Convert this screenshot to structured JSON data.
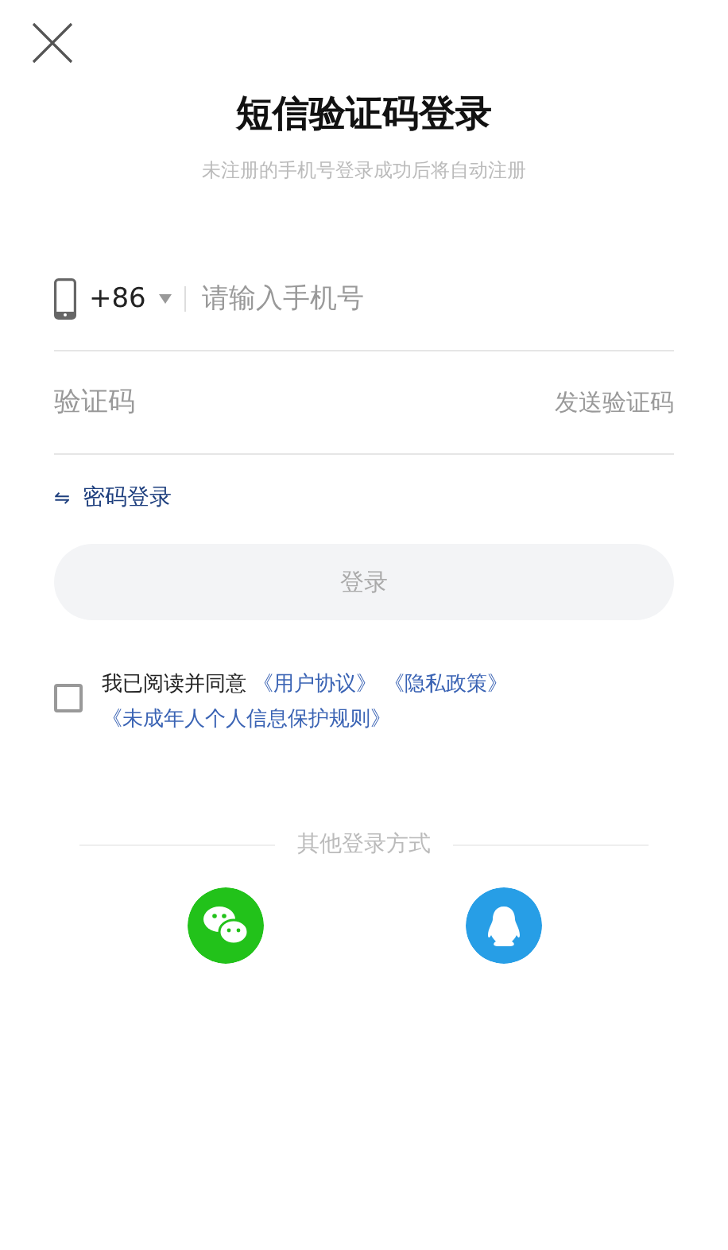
{
  "title": "短信验证码登录",
  "subtitle": "未注册的手机号登录成功后将自动注册",
  "phone_field": {
    "country_code": "+86",
    "placeholder": "请输入手机号"
  },
  "code_field": {
    "placeholder": "验证码",
    "send_button": "发送验证码"
  },
  "switch_link": {
    "icon": "⇋",
    "label": "密码登录"
  },
  "login_button": {
    "label": "登录",
    "disabled": true
  },
  "agreement": {
    "checked": false,
    "text": "我已阅读并同意",
    "links": [
      "《用户协议》",
      "《隐私政策》",
      "《未成年人个人信息保护规则》"
    ]
  },
  "other_login": {
    "label": "其他登录方式",
    "options": [
      {
        "kind": "wechat"
      },
      {
        "kind": "qq"
      }
    ]
  }
}
